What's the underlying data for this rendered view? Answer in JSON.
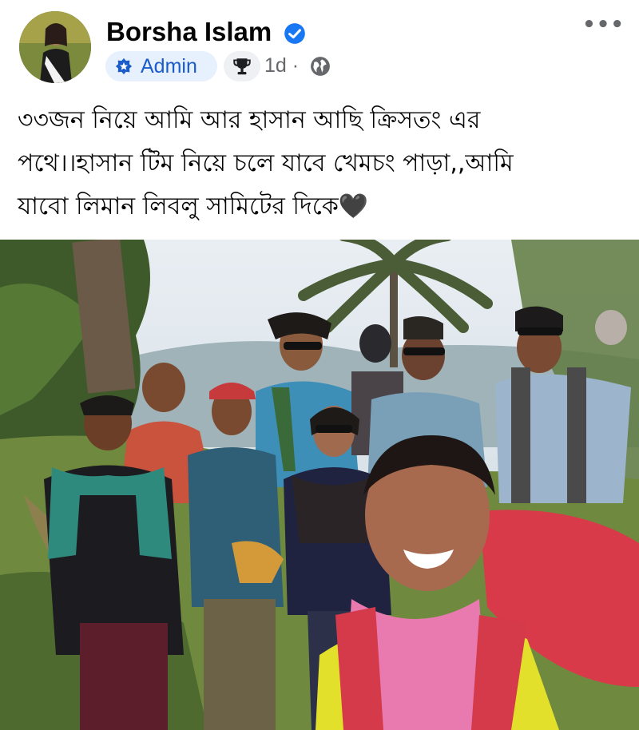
{
  "post": {
    "author": {
      "name": "Borsha Islam",
      "verified_icon": "verified-badge-icon"
    },
    "badges": {
      "admin_label": "Admin",
      "admin_icon": "star-badge-icon",
      "trophy_icon": "trophy-icon"
    },
    "timestamp": "1d",
    "separator": "·",
    "audience_icon": "globe-icon",
    "more_icon": "more-options-icon",
    "more_glyph": "•••",
    "text_lines": [
      "৩৩জন নিয়ে আমি আর হাসান আছি ক্রিসতং এর",
      "পথে।।হাসান টিম নিয়ে চলে যাবে খেমচং পাড়া,,আমি",
      "যাবো লিমান লিবলু সামিটের দিকে🖤"
    ]
  },
  "colors": {
    "accent": "#1877f2",
    "admin_bg": "#e7f0fd",
    "admin_text": "#1b5cc8",
    "muted": "#65676b"
  }
}
